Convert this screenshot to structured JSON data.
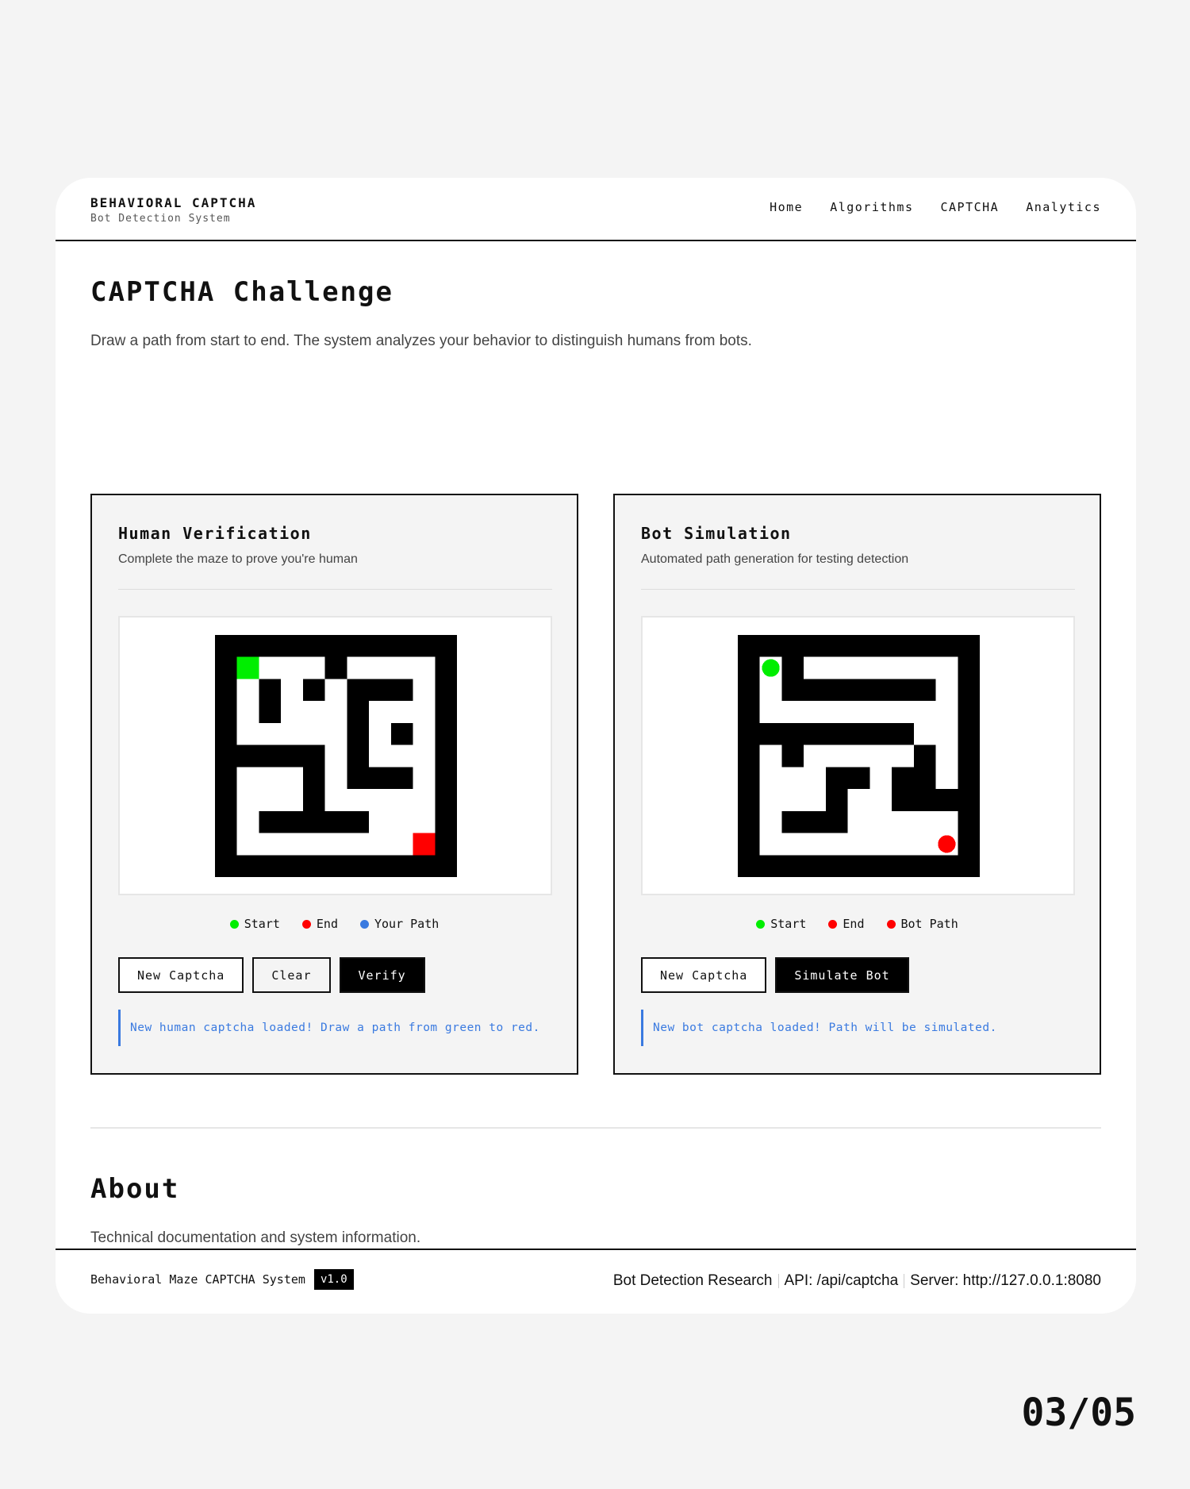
{
  "header": {
    "brand_title": "BEHAVIORAL CAPTCHA",
    "brand_subtitle": "Bot Detection System",
    "nav": [
      "Home",
      "Algorithms",
      "CAPTCHA",
      "Analytics"
    ]
  },
  "captcha_section": {
    "title": "CAPTCHA Challenge",
    "description": "Draw a path from start to end. The system analyzes your behavior to distinguish humans from bots."
  },
  "human_panel": {
    "title": "Human Verification",
    "subtitle": "Complete the maze to prove you're human",
    "legend": {
      "start": "Start",
      "end": "End",
      "path": "Your Path"
    },
    "buttons": {
      "new": "New Captcha",
      "clear": "Clear",
      "verify": "Verify"
    },
    "status": "New human captcha loaded! Draw a path from green to red."
  },
  "bot_panel": {
    "title": "Bot Simulation",
    "subtitle": "Automated path generation for testing detection",
    "legend": {
      "start": "Start",
      "end": "End",
      "path": "Bot Path"
    },
    "buttons": {
      "new": "New Captcha",
      "simulate": "Simulate Bot"
    },
    "status": "New bot captcha loaded! Path will be simulated."
  },
  "about_section": {
    "title": "About",
    "description": "Technical documentation and system information."
  },
  "footer": {
    "system_name": "Behavioral Maze CAPTCHA System",
    "version": "v1.0",
    "research": "Bot Detection Research",
    "api": "API: /api/captcha",
    "server": "Server: http://127.0.0.1:8080"
  },
  "page_counter": "03/05",
  "colors": {
    "start": "#00ee00",
    "end": "#ff0000",
    "your_path": "#3a7ae0",
    "status_accent": "#3a7ae0"
  }
}
